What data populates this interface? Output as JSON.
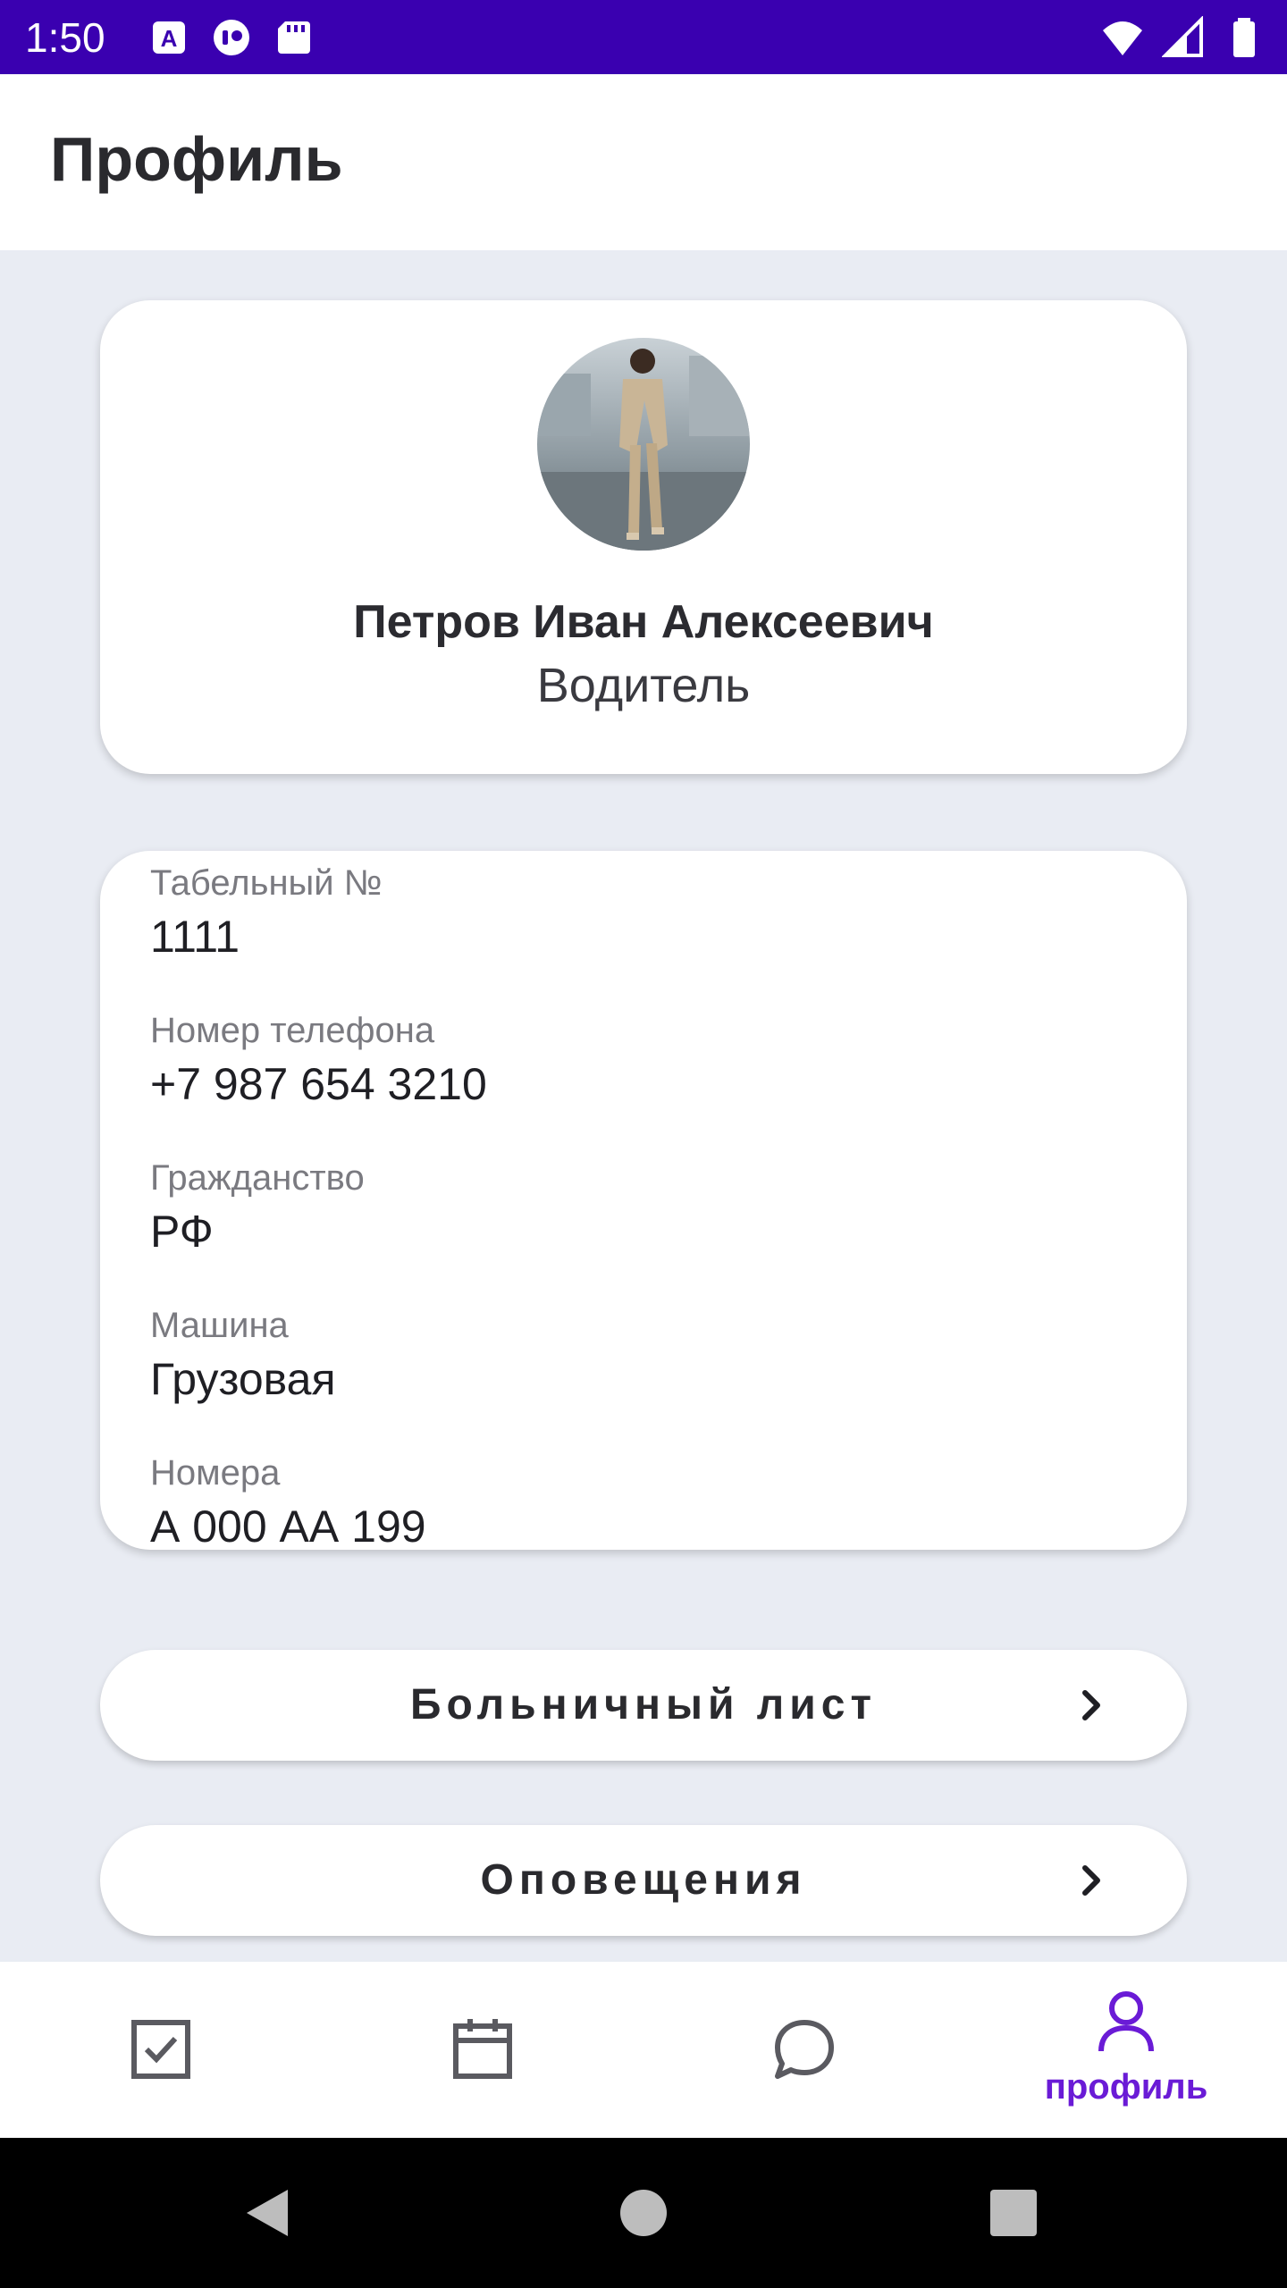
{
  "status_bar": {
    "time": "1:50",
    "left_icons": [
      "a-badge-icon",
      "record-icon",
      "sd-card-icon"
    ],
    "right_icons": [
      "wifi-icon",
      "signal-icon",
      "battery-icon"
    ],
    "background": "#3a00b0"
  },
  "app_bar": {
    "title": "Профиль"
  },
  "profile": {
    "name": "Петров Иван Алексеевич",
    "role": "Водитель"
  },
  "info": {
    "items": [
      {
        "label": "Табельный №",
        "value": "1111"
      },
      {
        "label": "Номер телефона",
        "value": "+7 987 654 3210"
      },
      {
        "label": "Гражданство",
        "value": "РФ"
      },
      {
        "label": "Машина",
        "value": "Грузовая"
      },
      {
        "label": "Номера",
        "value": "А 000 АА 199"
      }
    ]
  },
  "buttons": {
    "sick_leave": "Больничный лист",
    "notifications": "Оповещения"
  },
  "bottom_nav": {
    "tabs": [
      {
        "icon": "checkbox-icon",
        "active": false
      },
      {
        "icon": "calendar-icon",
        "active": false
      },
      {
        "icon": "chat-bubble-icon",
        "active": false
      },
      {
        "icon": "person-icon",
        "active": true,
        "label": "профиль"
      }
    ],
    "active_color": "#6a1bd6",
    "inactive_color": "#5a5a60"
  }
}
